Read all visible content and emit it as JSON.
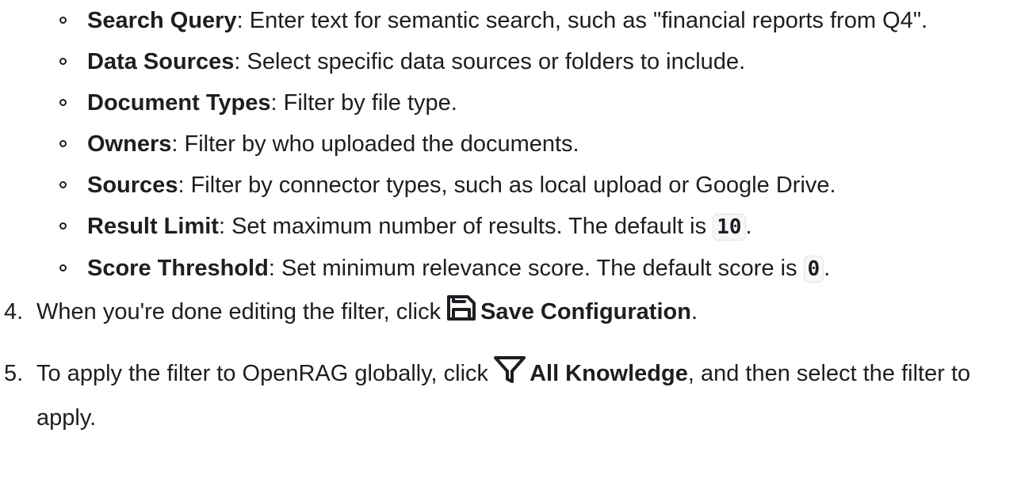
{
  "options": [
    {
      "term": "Search Query",
      "desc": ": Enter text for semantic search, such as \"financial reports from Q4\"."
    },
    {
      "term": "Data Sources",
      "desc": ": Select specific data sources or folders to include."
    },
    {
      "term": "Document Types",
      "desc": ": Filter by file type."
    },
    {
      "term": "Owners",
      "desc": ": Filter by who uploaded the documents."
    },
    {
      "term": "Sources",
      "desc": ": Filter by connector types, such as local upload or Google Drive."
    },
    {
      "term": "Result Limit",
      "desc": ": Set maximum number of results. The default is ",
      "code": "10",
      "after": "."
    },
    {
      "term": "Score Threshold",
      "desc": ": Set minimum relevance score. The default score is ",
      "code": "0",
      "after": "."
    }
  ],
  "steps": [
    {
      "num": "4.",
      "before": "When you're done editing the filter, click",
      "icon": "save-icon",
      "label": "Save Configuration",
      "after": "."
    },
    {
      "num": "5.",
      "before": "To apply the filter to OpenRAG globally, click",
      "icon": "filter-icon",
      "label": "All Knowledge",
      "after": ", and then select the filter to apply."
    }
  ]
}
